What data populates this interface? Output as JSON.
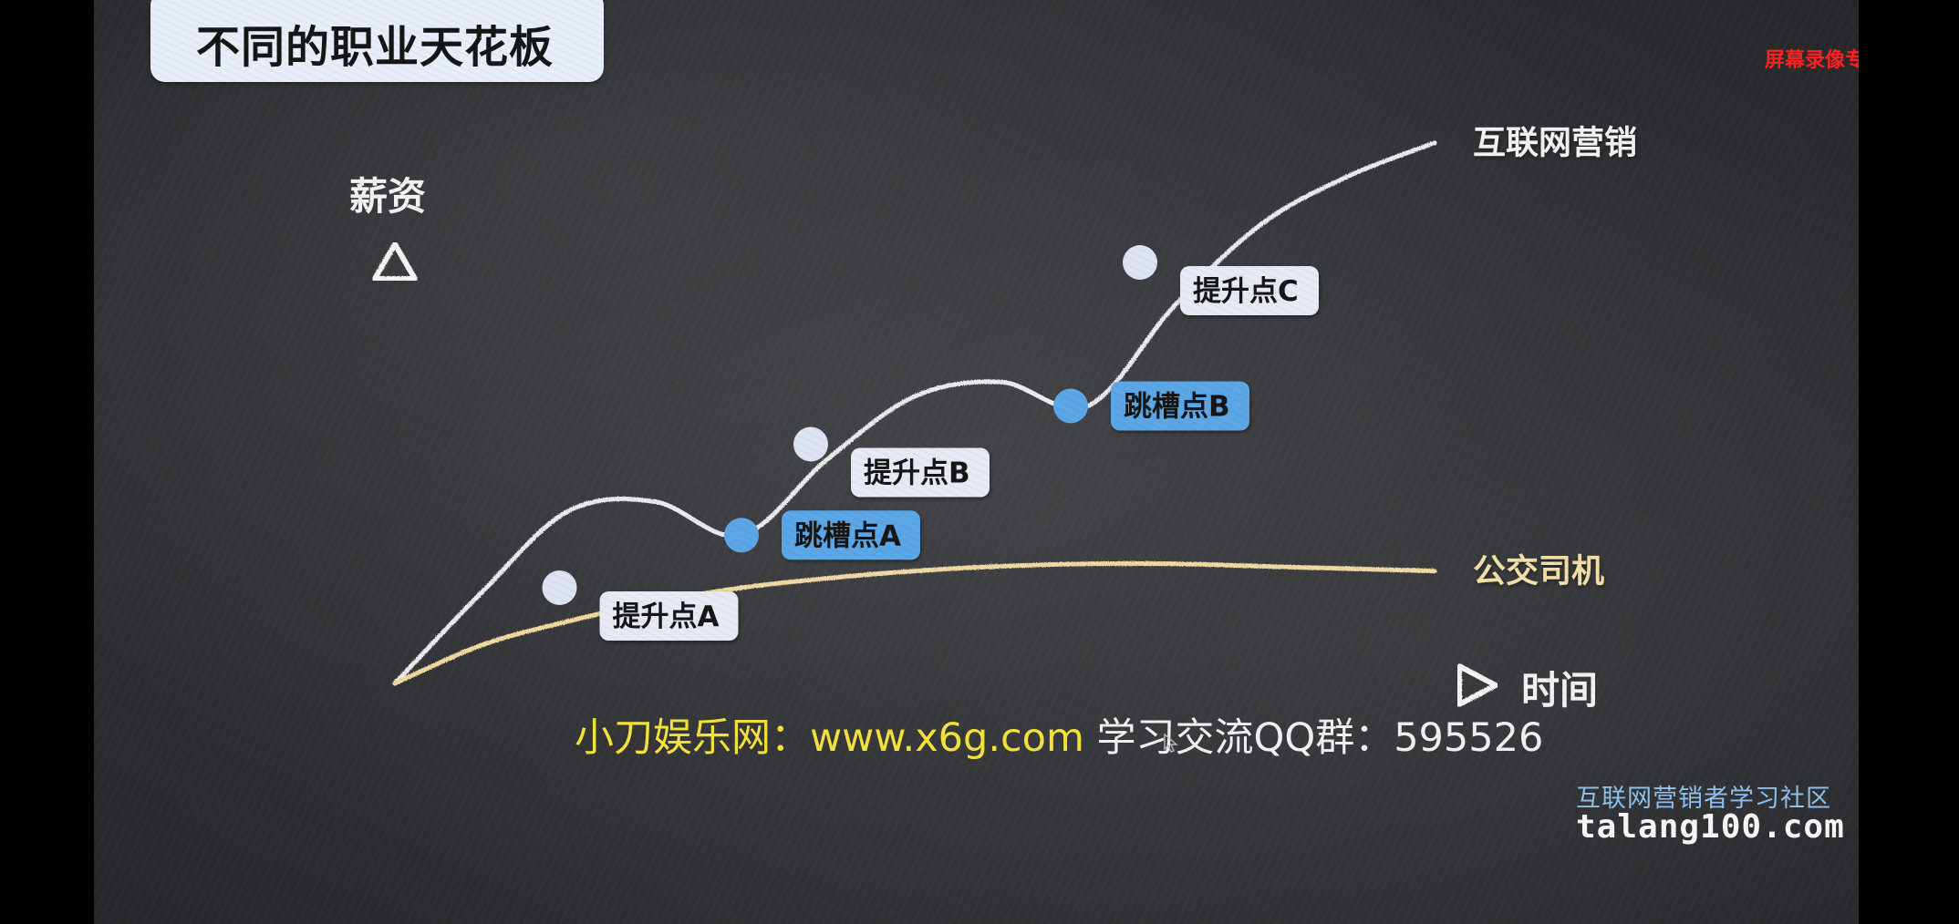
{
  "slide": {
    "title": "不同的职业天花板",
    "watermark": "屏幕录像专家 未注册"
  },
  "chart_data": {
    "type": "line",
    "ylabel": "薪资",
    "xlabel": "时间",
    "x": [
      0,
      1,
      2,
      3,
      4,
      5,
      6,
      7,
      8,
      9,
      10,
      11,
      12
    ],
    "series": [
      {
        "name": "互联网营销",
        "color": "#e9e9ee",
        "values": [
          0,
          1.9,
          3.6,
          3.8,
          3.1,
          4.7,
          6.0,
          6.3,
          5.8,
          7.9,
          9.6,
          10.6,
          11.3
        ]
      },
      {
        "name": "公交司机",
        "color": "#efd9a2",
        "values": [
          0,
          0.8,
          1.3,
          1.7,
          2.0,
          2.2,
          2.35,
          2.45,
          2.5,
          2.5,
          2.45,
          2.4,
          2.35
        ]
      }
    ],
    "points": [
      {
        "label": "提升点A",
        "x": 1.9,
        "y": 2.0,
        "kind": "promotion",
        "fill": "#dde3f2",
        "label_bg": "#e7eaf2"
      },
      {
        "label": "跳槽点A",
        "x": 4.0,
        "y": 3.1,
        "kind": "job-hop",
        "fill": "#5aa6e6",
        "label_bg": "#5aa6e6"
      },
      {
        "label": "提升点B",
        "x": 4.8,
        "y": 5.0,
        "kind": "promotion",
        "fill": "#dde3f2",
        "label_bg": "#e7eaf2"
      },
      {
        "label": "跳槽点B",
        "x": 7.8,
        "y": 5.8,
        "kind": "job-hop",
        "fill": "#5aa6e6",
        "label_bg": "#5aa6e6"
      },
      {
        "label": "提升点C",
        "x": 8.6,
        "y": 8.8,
        "kind": "promotion",
        "fill": "#dde3f2",
        "label_bg": "#e7eaf2"
      }
    ]
  },
  "caption": {
    "site": "小刀娱乐网：www.x6g.com",
    "group": " 学习交流QQ群：595526"
  },
  "brand": {
    "community": "互联网营销者学习社区",
    "domain": "talang100.com"
  }
}
